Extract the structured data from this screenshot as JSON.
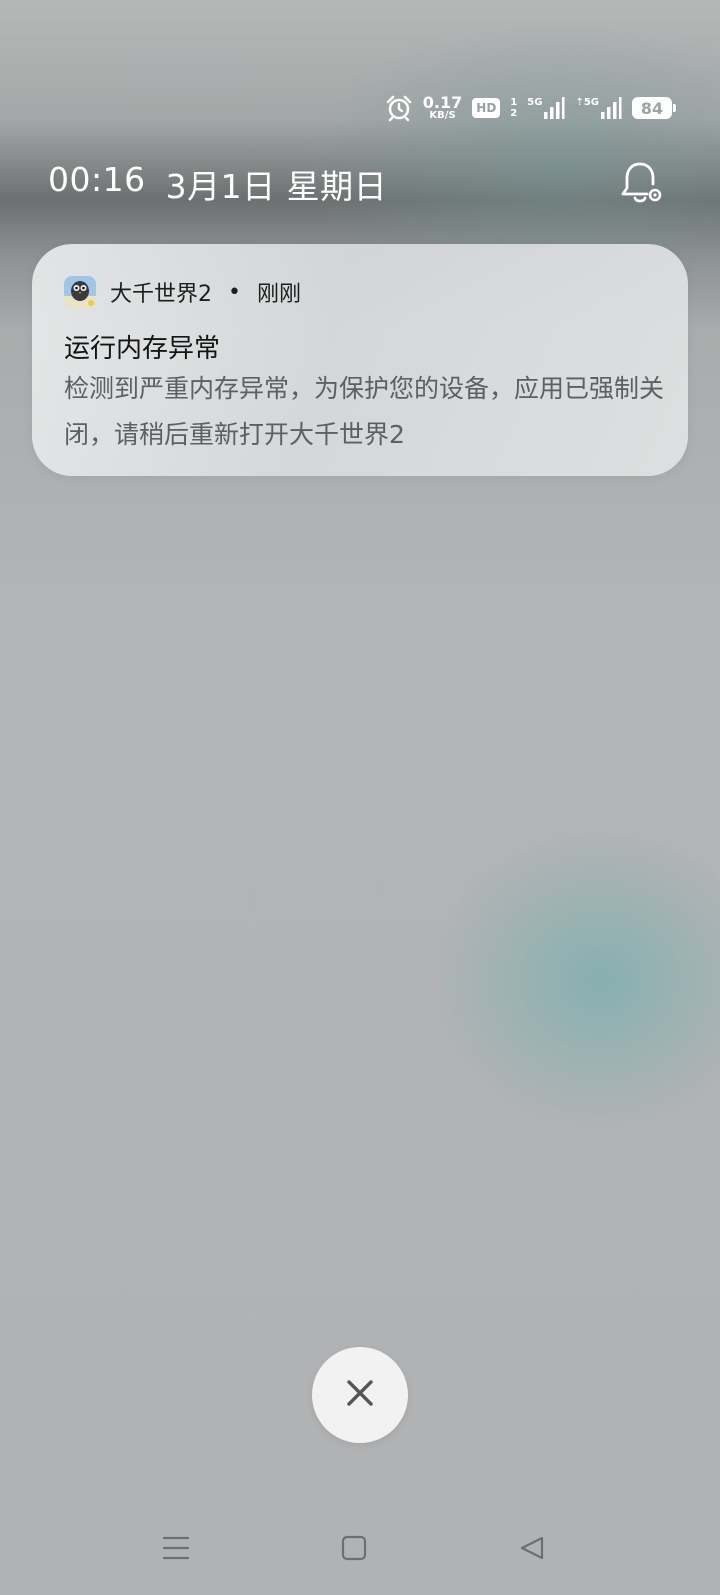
{
  "status_bar": {
    "alarm_icon": "alarm-clock-icon",
    "net_speed_value": "0.17",
    "net_speed_unit": "KB/S",
    "hd_label": "HD",
    "sim1_label": "5G",
    "sim2_label": "5G",
    "battery_level": "84"
  },
  "lockscreen": {
    "time": "00:16",
    "date": "3月1日",
    "weekday": "星期日",
    "bell_icon": "bell-settings-icon"
  },
  "notification": {
    "app_name": "大千世界2",
    "separator": "•",
    "time": "刚刚",
    "title": "运行内存异常",
    "body": "检测到严重内存异常，为保护您的设备，应用已强制关闭，请稍后重新打开大千世界2"
  },
  "dismiss_button": {
    "icon": "close-icon"
  },
  "navigation": {
    "menu_icon": "menu-icon",
    "home_icon": "home-square-icon",
    "back_icon": "back-triangle-icon"
  },
  "colors": {
    "card_bg": "#e4e6e7",
    "body_text": "#5d6061",
    "title_text": "#151515",
    "status_text": "#ffffff"
  }
}
